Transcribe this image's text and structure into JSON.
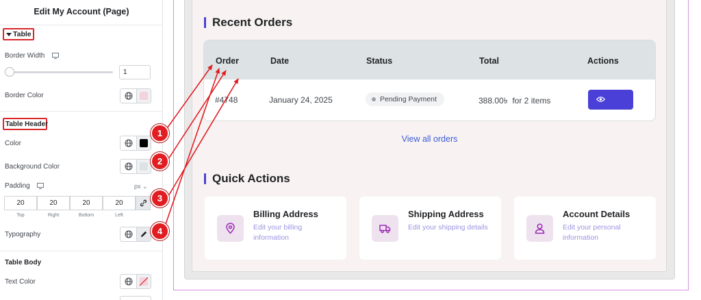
{
  "panel": {
    "title": "Edit My Account (Page)",
    "table_section": "Table",
    "border_width_label": "Border Width",
    "border_width_value": "1",
    "border_width_slider_value": 1,
    "border_color_label": "Border Color",
    "table_header_section": "Table Header",
    "color_label": "Color",
    "background_color_label": "Background Color",
    "padding_label": "Padding",
    "padding_unit": "px",
    "padding": {
      "top": "20",
      "right": "20",
      "bottom": "20",
      "left": "20",
      "top_label": "Top",
      "right_label": "Right",
      "bottom_label": "Bottom",
      "left_label": "Left"
    },
    "typography_label": "Typography",
    "table_body_section": "Table Body",
    "text_color_label": "Text Color",
    "swatches": {
      "border_color": "#f3d3dc",
      "header_color": "#000000",
      "header_background": "#dde3e4"
    }
  },
  "recent_orders": {
    "heading": "Recent Orders",
    "columns": [
      "Order",
      "Date",
      "Status",
      "Total",
      "Actions"
    ],
    "row": {
      "order": "#4748",
      "date": "January 24, 2025",
      "status": "Pending Payment",
      "total": "388.00৳  for 2 items"
    },
    "view_all": "View all orders"
  },
  "quick_actions": {
    "heading": "Quick Actions",
    "cards": [
      {
        "title": "Billing Address",
        "desc": "Edit your billing information",
        "icon": "location-pin-icon"
      },
      {
        "title": "Shipping Address",
        "desc": "Edit your shipping details",
        "icon": "truck-icon"
      },
      {
        "title": "Account Details",
        "desc": "Edit your personal information",
        "icon": "user-icon"
      }
    ]
  },
  "annotations": [
    "1",
    "2",
    "3",
    "4"
  ],
  "colors": {
    "accent": "#4a3fd6",
    "annotation_red": "#e11d22",
    "header_bg": "#dde3e4",
    "link_blue": "#3d5bd6"
  }
}
